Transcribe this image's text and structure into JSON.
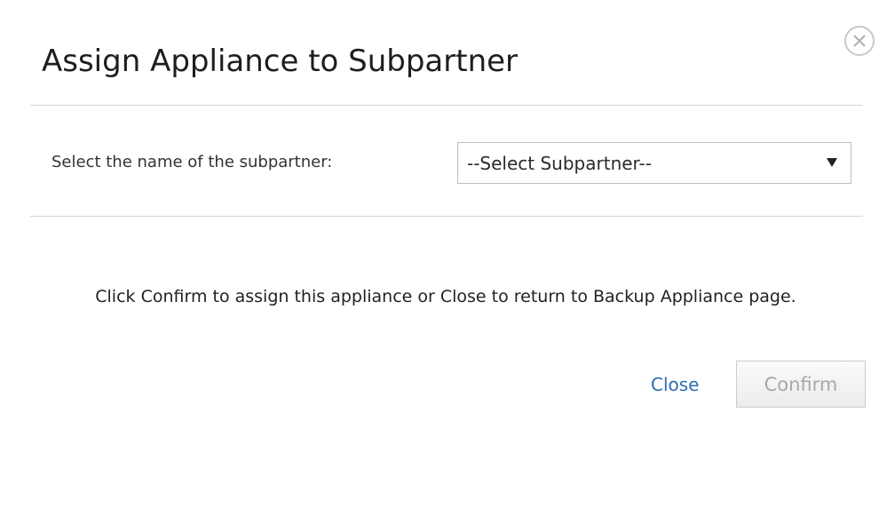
{
  "dialog": {
    "title": "Assign Appliance to Subpartner",
    "close_icon": "close-x-icon"
  },
  "subpartner_select": {
    "label": "Select the name of the subpartner:",
    "selected_value": "--Select Subpartner--",
    "arrow_icon": "triangle-down-icon"
  },
  "message": {
    "text": "Click Confirm to assign this appliance or Close to return to Backup Appliance page."
  },
  "actions": {
    "close_label": "Close",
    "confirm_label": "Confirm",
    "confirm_disabled": true,
    "link_color": "#2f6db5"
  }
}
